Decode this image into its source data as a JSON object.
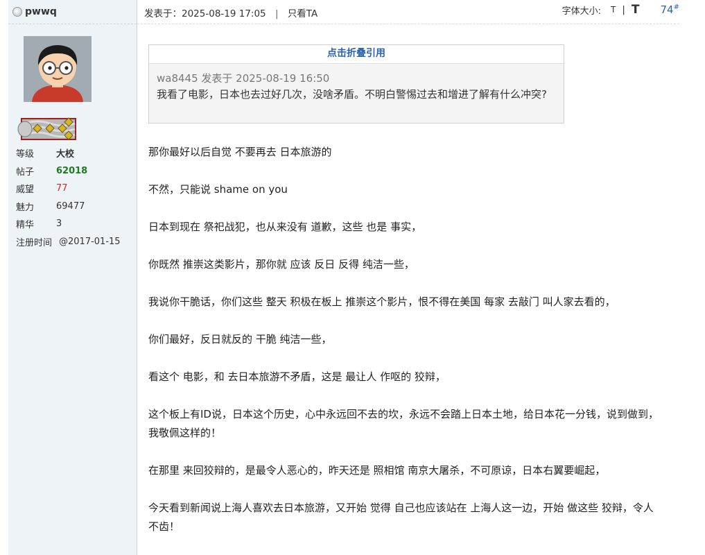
{
  "user": {
    "name": "pwwq",
    "stats": [
      {
        "label": "等级",
        "value": "大校",
        "style": "bold"
      },
      {
        "label": "帖子",
        "value": "62018",
        "style": "green"
      },
      {
        "label": "威望",
        "value": "77",
        "style": "red"
      },
      {
        "label": "魅力",
        "value": "69477",
        "style": "normal"
      },
      {
        "label": "精华",
        "value": "3",
        "style": "normal"
      },
      {
        "label": "注册时间",
        "value": "@2017-01-15",
        "style": "normal"
      }
    ]
  },
  "post": {
    "posted_at": "发表于：2025-08-19 17:05",
    "only_author": "只看TA",
    "font_size_label": "字体大小:",
    "font_small": "T",
    "font_sep": "|",
    "font_big": "T",
    "floor_number": "74",
    "floor_suffix": "#"
  },
  "quote": {
    "toggle_label": "点击折叠引用",
    "author_line": "wa8445 发表于 2025-08-19 16:50",
    "text": "我看了电影，日本也去过好几次，没啥矛盾。不明白警惕过去和增进了解有什么冲突?"
  },
  "content": {
    "paragraphs": [
      "那你最好以后自觉 不要再去 日本旅游的",
      "不然，只能说 shame on you",
      "日本到现在 祭祀战犯，也从来没有 道歉，这些 也是 事实，",
      "你既然 推崇这类影片，那你就 应该 反日 反得 纯洁一些，",
      "我说你干脆话，你们这些 整天 积极在板上 推崇这个影片，恨不得在美国 每家 去敲门 叫人家去看的，",
      "你们最好，反日就反的 干脆 纯洁一些，",
      "看这个 电影，和 去日本旅游不矛盾，这是 最让人 作呕的 狡辩，",
      "这个板上有ID说，日本这个历史，心中永远回不去的坎，永远不会踏上日本土地，给日本花一分钱，说到做到，我敬佩这样的！",
      "在那里 来回狡辩的，是最令人恶心的，昨天还是 照相馆 南京大屠杀，不可原谅，日本右翼要崛起，",
      "今天看到新闻说上海人喜欢去日本旅游，又开始 觉得 自己也应该站在 上海人这一边，开始 做这些 狡辩，令人不齿！"
    ]
  },
  "colors": {
    "sidebar_bg": "#eef3f8",
    "link_blue": "#2a64b0",
    "posts_green": "#1f7a1f",
    "prestige_red": "#d0281c"
  }
}
